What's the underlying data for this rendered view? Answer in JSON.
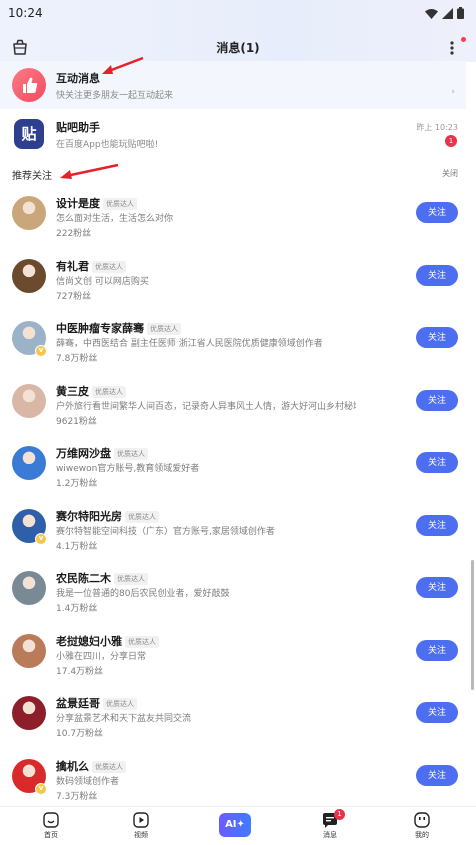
{
  "status": {
    "time": "10:24"
  },
  "nav": {
    "title": "消息(1)"
  },
  "interaction": {
    "title": "互动消息",
    "subtitle": "快关注更多朋友一起互动起来"
  },
  "assistant": {
    "title": "贴吧助手",
    "subtitle": "在百度App也能玩贴吧啦!",
    "time": "昨上 10:23",
    "badge": "1",
    "icon_text": "贴"
  },
  "recommend": {
    "title": "推荐关注",
    "close": "关闭"
  },
  "users": [
    {
      "name": "设计是度",
      "tag": "优质达人",
      "desc": "怎么面对生活，生活怎么对你",
      "fans": "222粉丝",
      "follow": "关注",
      "color": "#c9a77b",
      "verified": false
    },
    {
      "name": "有礼君",
      "tag": "优质达人",
      "desc": "信尚文创  可以网店购买",
      "fans": "727粉丝",
      "follow": "关注",
      "color": "#6b4a2d",
      "verified": false
    },
    {
      "name": "中医肿瘤专家薛骞",
      "tag": "优质达人",
      "desc": "薛骞，中西医结合 副主任医师 浙江省人民医院优质健康领域创作者",
      "fans": "7.8万粉丝",
      "follow": "关注",
      "color": "#9bb3c8",
      "verified": true
    },
    {
      "name": "黄三皮",
      "tag": "优质达人",
      "desc": "户外旅行看世间繁华人间百态，记录奇人异事风土人情，游大好河山乡村秘境。",
      "fans": "9621粉丝",
      "follow": "关注",
      "color": "#d8b7a6",
      "verified": false
    },
    {
      "name": "万维网沙盘",
      "tag": "优质达人",
      "desc": "wiwewon官方账号,教育领域爱好者",
      "fans": "1.2万粉丝",
      "follow": "关注",
      "color": "#3a7bd5",
      "verified": false
    },
    {
      "name": "赛尔特阳光房",
      "tag": "优质达人",
      "desc": "赛尔特智能空间科技（广东）官方账号,家居领域创作者",
      "fans": "4.1万粉丝",
      "follow": "关注",
      "color": "#2f5fa8",
      "verified": true
    },
    {
      "name": "农民陈二木",
      "tag": "优质达人",
      "desc": "我是一位普通的80后农民创业者，爱好敲鼓",
      "fans": "1.4万粉丝",
      "follow": "关注",
      "color": "#7a8a95",
      "verified": false
    },
    {
      "name": "老挝媳妇小雅",
      "tag": "优质达人",
      "desc": "小雅在四川，分享日常",
      "fans": "17.4万粉丝",
      "follow": "关注",
      "color": "#b97b5a",
      "verified": false
    },
    {
      "name": "盆景廷哥",
      "tag": "优质达人",
      "desc": "分享盆景艺术和天下盆友共同交流",
      "fans": "10.7万粉丝",
      "follow": "关注",
      "color": "#8c1f2a",
      "verified": false
    },
    {
      "name": "擒机么",
      "tag": "优质达人",
      "desc": "数码领域创作者",
      "fans": "7.3万粉丝",
      "follow": "关注",
      "color": "#d82a2a",
      "verified": true
    }
  ],
  "tabs": [
    {
      "label": "首页",
      "icon": "home-icon"
    },
    {
      "label": "视频",
      "icon": "video-icon"
    },
    {
      "label": "AI",
      "icon": "ai-icon"
    },
    {
      "label": "消息",
      "icon": "message-icon",
      "badge": "1"
    },
    {
      "label": "我的",
      "icon": "profile-icon"
    }
  ],
  "colors": {
    "accent": "#4e6ef2",
    "badge": "#e8334a",
    "arrow": "#e5212b"
  }
}
